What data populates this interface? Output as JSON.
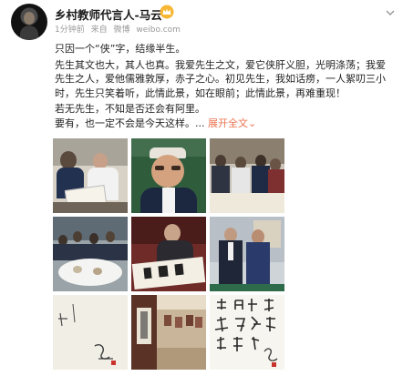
{
  "post": {
    "author": "乡村教师代言人-马云",
    "time": "1分钟前",
    "source_prefix": "来自",
    "source": "微博",
    "source_url": "weibo.com",
    "paragraphs": [
      "只因一个“侠”字，结缘半生。",
      "先生其文也大，其人也真。我爱先生之文，爱它侠肝义胆，光明涤荡；我爱先生之人，爱他儒雅敦厚，赤子之心。初见先生，我如话痨，一人絮叨三小时，先生只笑着听，此情此景，如在眼前；此情此景，再难重现！",
      "若无先生，不知是否还会有阿里。"
    ],
    "last_line": "要有，也一定不会是今天这样。",
    "ellipsis": "...",
    "expand_label": "展开全文",
    "expand_arrow": "⌄",
    "accent_color": "#eb7350"
  },
  "photos": [
    {
      "name": "photo-1",
      "desc": "reading-together"
    },
    {
      "name": "photo-2",
      "desc": "portrait-smiling"
    },
    {
      "name": "photo-3",
      "desc": "group-meeting"
    },
    {
      "name": "photo-4",
      "desc": "dinner-gathering"
    },
    {
      "name": "photo-5",
      "desc": "calligraphy-writing"
    },
    {
      "name": "photo-6",
      "desc": "two-men-standing"
    },
    {
      "name": "photo-7",
      "desc": "calligraphy-signature"
    },
    {
      "name": "photo-8",
      "desc": "gallery-hall"
    },
    {
      "name": "photo-9",
      "desc": "calligraphy-scroll"
    }
  ]
}
